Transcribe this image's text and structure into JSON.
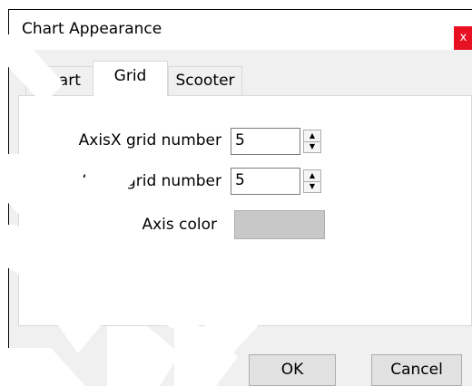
{
  "window": {
    "title": "Chart Appearance",
    "close_label": "x"
  },
  "tabs": [
    {
      "label": "Chart",
      "active": false
    },
    {
      "label": "Grid",
      "active": true
    },
    {
      "label": "Scooter",
      "active": false
    }
  ],
  "grid_settings": {
    "axis_x_label": "AxisX grid number",
    "axis_x_value": "5",
    "axis_y_label": "AxisY grid number",
    "axis_y_value": "5",
    "axis_color_label": "Axis color",
    "axis_color": "#c8c8c8"
  },
  "buttons": {
    "ok": "OK",
    "cancel": "Cancel"
  },
  "icons": {
    "spin_up": "triangle-up",
    "spin_down": "triangle-down",
    "watermark": "decorative-brush-strokes"
  },
  "colors": {
    "close_button": "#e81123",
    "dialog_background": "#f0f0f0",
    "panel_background": "#ffffff"
  }
}
